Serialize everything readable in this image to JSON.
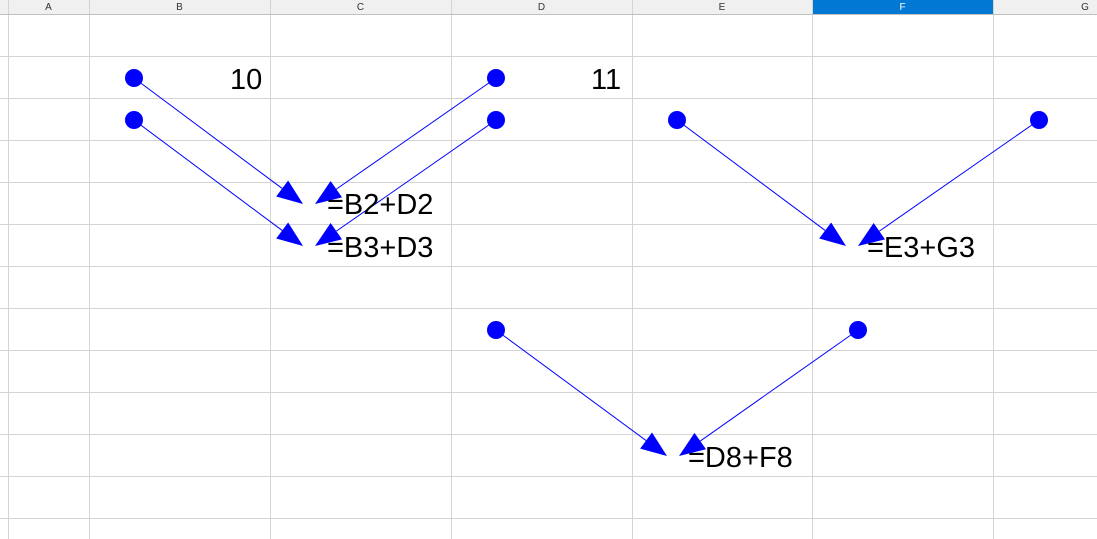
{
  "app": {
    "accent": "#0078d4",
    "header_bg": "#f0f0f0",
    "gridline": "#d4d4d4",
    "trace_color": "#0000ff"
  },
  "sheet": {
    "columns": [
      "A",
      "B",
      "C",
      "D",
      "E",
      "F",
      "G"
    ],
    "selected_column": "F",
    "cells": {
      "C2": "10",
      "E2": "11",
      "C5": "=B2+D2",
      "C6": "=B3+D3",
      "F6": "=E3+G3",
      "E11": "=D8+F8"
    }
  },
  "trace_arrows": [
    {
      "from": "B2",
      "to": "C5"
    },
    {
      "from": "D2",
      "to": "C5"
    },
    {
      "from": "B3",
      "to": "C6"
    },
    {
      "from": "D3",
      "to": "C6"
    },
    {
      "from": "E3",
      "to": "F6"
    },
    {
      "from": "G3",
      "to": "F6"
    },
    {
      "from": "D8",
      "to": "E11"
    },
    {
      "from": "F8",
      "to": "E11"
    }
  ]
}
